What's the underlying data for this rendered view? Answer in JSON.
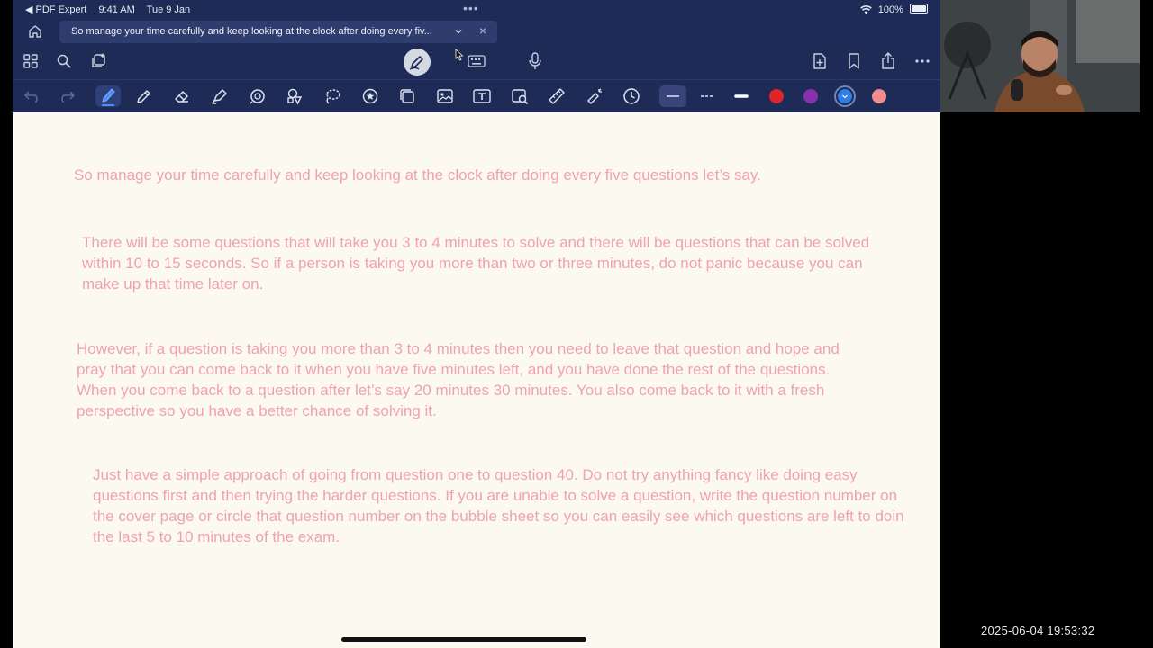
{
  "status_bar": {
    "back_app": "◀ PDF Expert",
    "time": "9:41 AM",
    "date": "Tue 9 Jan",
    "battery": "100%",
    "dots": "•••"
  },
  "tab": {
    "title": "So manage your time carefully and keep looking at the clock after doing every fiv...",
    "close": "×"
  },
  "document": {
    "paragraphs": [
      "So manage your time carefully and keep looking at the clock after doing every five questions let’s say.",
      "There will be some questions that will take you 3 to 4 minutes to solve and there will be questions that can be solved within 10 to 15 seconds. So if a person is taking you more than two or three minutes, do not panic because you can make up that time later on.",
      "However, if a question is taking you more than 3 to 4 minutes then you need to leave that question and hope and pray that you can come back to it when you have five minutes left, and you have done the rest of the questions. When you come back to a question after let’s say 20 minutes 30 minutes. You also come back to it with a fresh perspective so you have a better chance of solving it.",
      "Just have a simple approach of going from question one to question 40. Do not try anything fancy like doing easy questions first and then trying the harder questions. If you are unable to solve a question, write the question number on the cover page or circle that question number on the bubble sheet so you can easily see which questions are left to doin the last 5 to 10 minutes of the exam."
    ]
  },
  "colors": {
    "chrome": "#1e2b57",
    "page_bg": "#fcf9f0",
    "text": "#f0a1b3",
    "swatches": [
      "#e0242a",
      "#8a2fb0",
      "#2f7ee8",
      "#f28c8c"
    ]
  },
  "overlay": {
    "timestamp": "2025-06-04 19:53:32"
  }
}
